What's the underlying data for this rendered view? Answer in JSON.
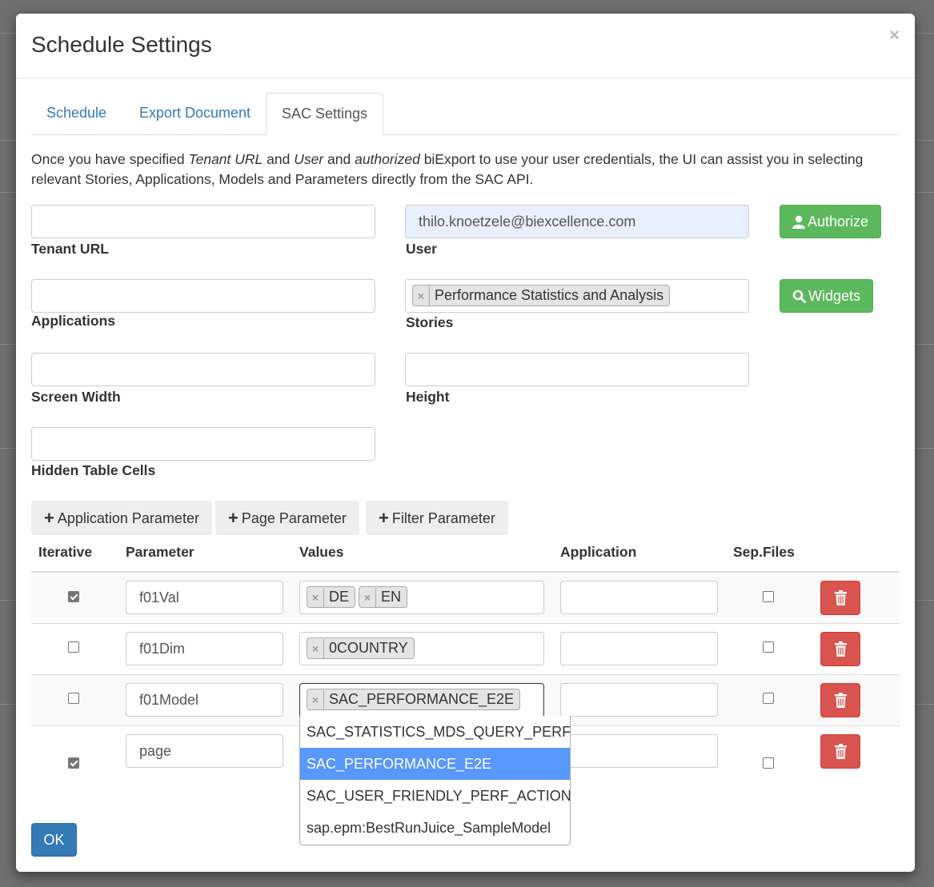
{
  "modal": {
    "title": "Schedule Settings",
    "close": "×"
  },
  "tabs": [
    {
      "label": "Schedule"
    },
    {
      "label": "Export Document"
    },
    {
      "label": "SAC Settings"
    }
  ],
  "intro": {
    "p1": "Once you have specified ",
    "tenant_url": "Tenant URL",
    "and1": " and ",
    "user": "User",
    "and2": " and ",
    "authorized": "authorized",
    "p2": " biExport to use your user credentials, the UI can assist you in selecting relevant Stories, Applications, Models and Parameters directly from the SAC API."
  },
  "form": {
    "tenant_url": {
      "label": "Tenant URL",
      "value": ""
    },
    "user": {
      "label": "User",
      "value": "thilo.knoetzele@biexcellence.com"
    },
    "authorize_button": "Authorize",
    "applications": {
      "label": "Applications",
      "value": ""
    },
    "stories": {
      "label": "Stories",
      "tags": [
        "Performance Statistics and Analysis"
      ]
    },
    "widgets_button": "Widgets",
    "screen_width": {
      "label": "Screen Width",
      "value": ""
    },
    "height": {
      "label": "Height",
      "value": ""
    },
    "hidden_table_cells": {
      "label": "Hidden Table Cells",
      "value": ""
    }
  },
  "param_buttons": {
    "application": "Application Parameter",
    "page": "Page Parameter",
    "filter": "Filter Parameter"
  },
  "table": {
    "headers": {
      "iterative": "Iterative",
      "parameter": "Parameter",
      "values": "Values",
      "application": "Application",
      "sep_files": "Sep.Files"
    },
    "rows": [
      {
        "iterative": true,
        "parameter": "f01Val",
        "values": [
          "DE",
          "EN"
        ],
        "application": "",
        "sep_files": false
      },
      {
        "iterative": false,
        "parameter": "f01Dim",
        "values": [
          "0COUNTRY"
        ],
        "application": "",
        "sep_files": false
      },
      {
        "iterative": false,
        "parameter": "f01Model",
        "values": [
          "SAC_PERFORMANCE_E2E"
        ],
        "application": "",
        "sep_files": false
      },
      {
        "iterative": true,
        "parameter": "page",
        "values": [],
        "application": "",
        "sep_files": false
      }
    ]
  },
  "dropdown": {
    "options": [
      "SAC_STATISTICS_MDS_QUERY_PERF",
      "SAC_PERFORMANCE_E2E",
      "SAC_USER_FRIENDLY_PERF_ACTION",
      "sap.epm:BestRunJuice_SampleModel"
    ],
    "highlighted": "SAC_PERFORMANCE_E2E"
  },
  "ok_button": "OK",
  "colors": {
    "primary": "#337ab7",
    "success": "#5cb85c",
    "danger": "#d9534f",
    "highlight": "#5897fb",
    "autofill": "#e8f0fe"
  }
}
